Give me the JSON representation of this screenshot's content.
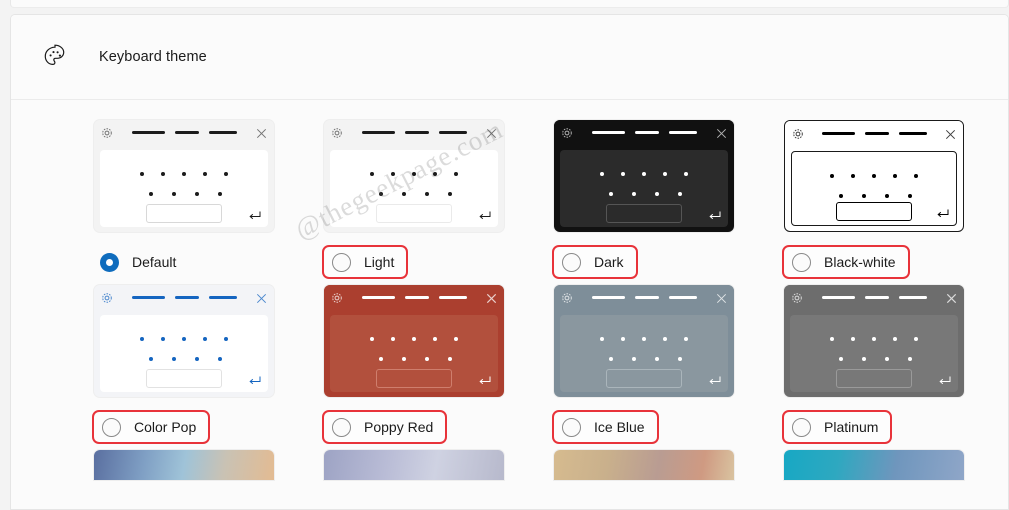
{
  "header": {
    "title": "Keyboard theme",
    "icon": "palette-icon"
  },
  "watermark": "@thegeekpage.com",
  "colors": {
    "accent_selected": "#0f6cbd",
    "highlight_box": "#e8333a",
    "page_bg": "#f3f3f3",
    "card_bg": "#fbfbfb"
  },
  "themes": [
    {
      "name": "Default",
      "selected": true,
      "highlighted": false,
      "preview": {
        "head_bg": "#f3f3f3",
        "body_bg": "#ffffff",
        "dash": "#1b1b1b",
        "dot": "#1b1b1b",
        "icon": "#4a4a4a",
        "spacebar_bg": "#ffffff",
        "spacebar_border": "#d8d8d8",
        "enter": "#1b1b1b",
        "outlined": false
      }
    },
    {
      "name": "Light",
      "selected": false,
      "highlighted": true,
      "preview": {
        "head_bg": "#f3f3f3",
        "body_bg": "#ffffff",
        "dash": "#1b1b1b",
        "dot": "#1b1b1b",
        "icon": "#4a4a4a",
        "spacebar_bg": "#ffffff",
        "spacebar_border": "#eaeaea",
        "enter": "#1b1b1b",
        "outlined": false
      }
    },
    {
      "name": "Dark",
      "selected": false,
      "highlighted": true,
      "preview": {
        "head_bg": "#111111",
        "body_bg": "#2b2b2b",
        "dash": "#ffffff",
        "dot": "#ffffff",
        "icon": "#e6e6e6",
        "spacebar_bg": "#2b2b2b",
        "spacebar_border": "#555555",
        "enter": "#ffffff",
        "outlined": false
      }
    },
    {
      "name": "Black-white",
      "selected": false,
      "highlighted": true,
      "preview": {
        "head_bg": "#ffffff",
        "body_bg": "#ffffff",
        "dash": "#000000",
        "dot": "#000000",
        "icon": "#000000",
        "spacebar_bg": "#ffffff",
        "spacebar_border": "#000000",
        "enter": "#000000",
        "outlined": true
      }
    },
    {
      "name": "Color Pop",
      "selected": false,
      "highlighted": true,
      "preview": {
        "head_bg": "#f3f4f7",
        "body_bg": "#ffffff",
        "dash": "#1565c0",
        "dot": "#1565c0",
        "icon": "#1565c0",
        "spacebar_bg": "#ffffff",
        "spacebar_border": "#e2e2e2",
        "enter": "#1565c0",
        "outlined": false
      }
    },
    {
      "name": "Poppy Red",
      "selected": false,
      "highlighted": true,
      "preview": {
        "head_bg": "#ab3f2f",
        "body_bg": "#b2503d",
        "dash": "#ffffff",
        "dot": "#ffffff",
        "icon": "#ffffff",
        "spacebar_bg": "#b2503d",
        "spacebar_border": "#cf7e6d",
        "enter": "#ffffff",
        "outlined": false
      }
    },
    {
      "name": "Ice Blue",
      "selected": false,
      "highlighted": true,
      "preview": {
        "head_bg": "#7e8e99",
        "body_bg": "#8a979f",
        "dash": "#ffffff",
        "dot": "#ffffff",
        "icon": "#ffffff",
        "spacebar_bg": "#8a979f",
        "spacebar_border": "#aab5bb",
        "enter": "#ffffff",
        "outlined": false
      }
    },
    {
      "name": "Platinum",
      "selected": false,
      "highlighted": true,
      "preview": {
        "head_bg": "#6d6d6d",
        "body_bg": "#787878",
        "dash": "#ffffff",
        "dot": "#ffffff",
        "icon": "#ffffff",
        "spacebar_bg": "#787878",
        "spacebar_border": "#9a9a9a",
        "enter": "#ffffff",
        "outlined": false
      }
    }
  ],
  "partial_row": [
    {
      "gradient": "linear-gradient(100deg, #5a6fa0 0%, #7f9fc4 28%, #9fc3d8 50%, #c9c2b4 72%, #e3bb92 100%)"
    },
    {
      "gradient": "linear-gradient(100deg, #9da3c4 0%, #b9bcd6 35%, #cfd2e2 62%, #b7b9cc 100%)"
    },
    {
      "gradient": "linear-gradient(100deg, #d6bb8f 0%, #c9b08c 30%, #b99c92 58%, #cf9a82 82%, #d9c3a0 100%)"
    },
    {
      "gradient": "linear-gradient(100deg, #17a8c4 0%, #2ea8c0 30%, #6f96bd 62%, #8fa6c8 100%)"
    }
  ]
}
